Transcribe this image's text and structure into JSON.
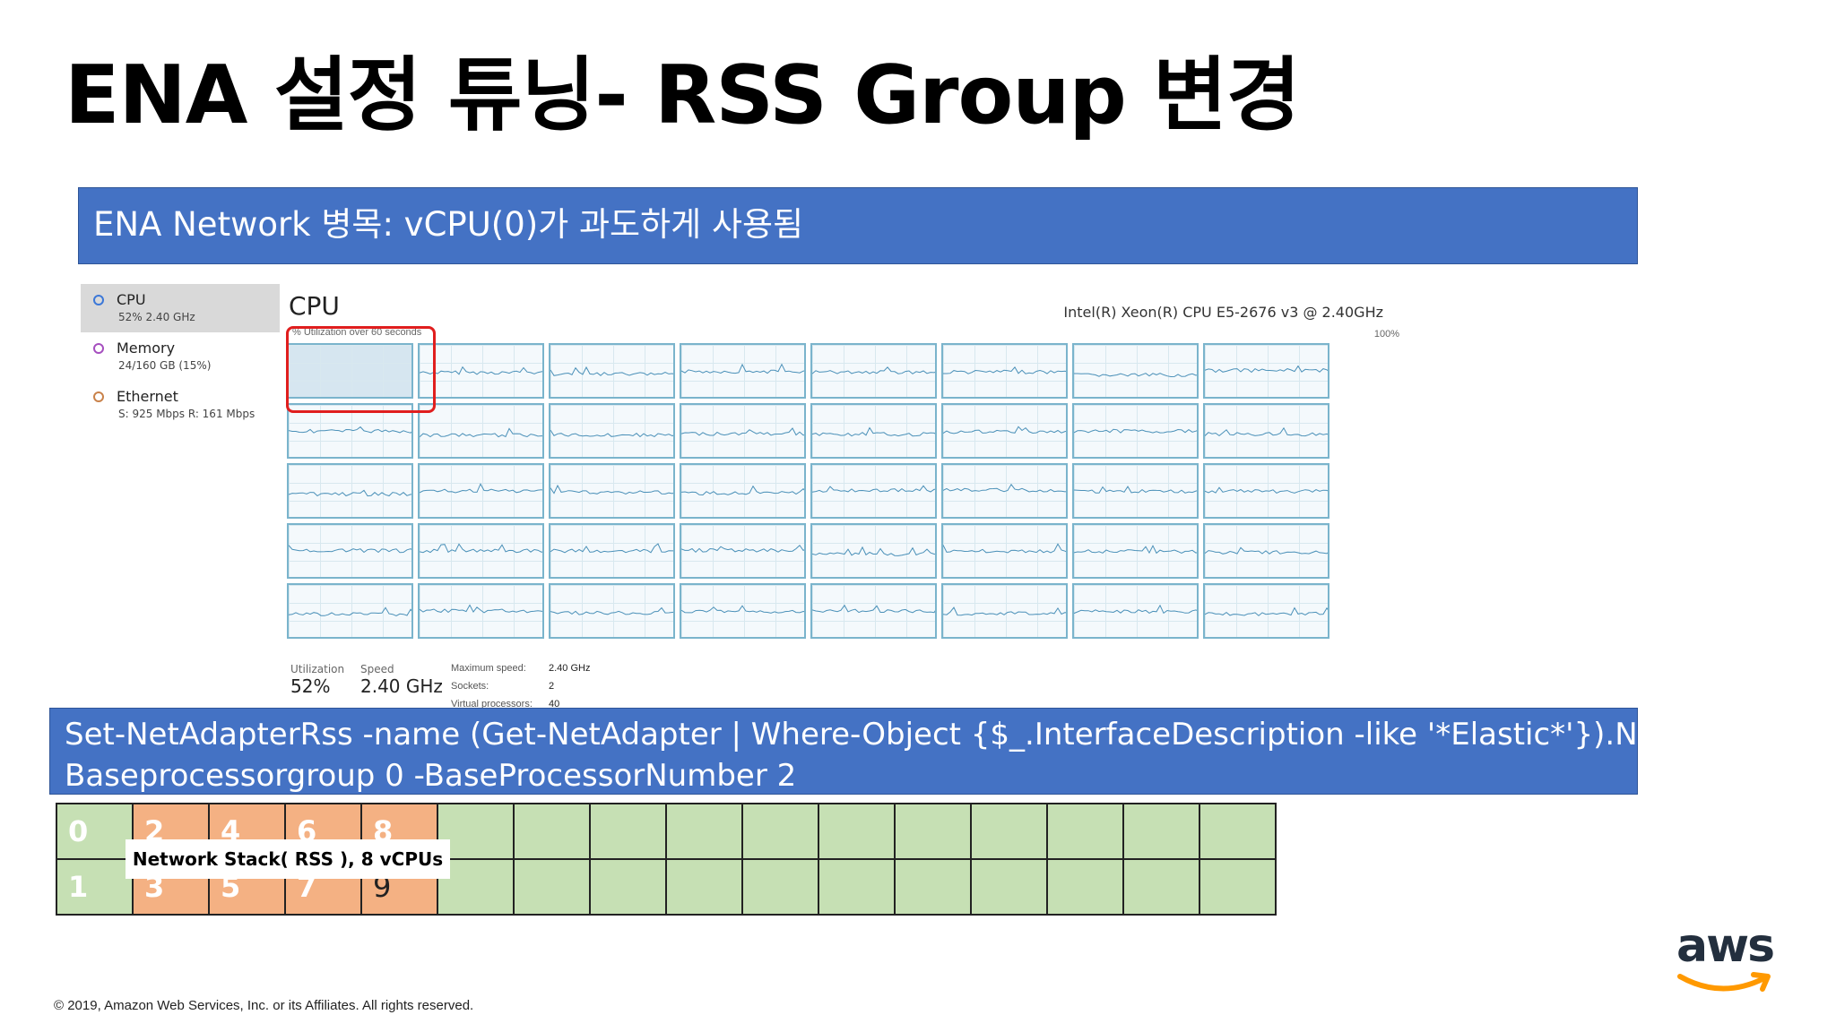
{
  "slide": {
    "title": "ENA 설정 튜닝- RSS Group 변경",
    "top_banner": "ENA Network 병목: vCPU(0)가 과도하게 사용됨",
    "command_line1": "Set-NetAdapterRss -name (Get-NetAdapter | Where-Object {$_.InterfaceDescription -like '*Elastic*'}).Name -",
    "command_line2": "Baseprocessorgroup 0 -BaseProcessorNumber 2",
    "network_stack_label": "Network Stack( RSS ), 8 vCPUs",
    "copyright": "© 2019, Amazon Web Services, Inc. or its Affiliates. All rights reserved.",
    "logo_text": "aws"
  },
  "task_manager": {
    "sidebar": [
      {
        "name": "CPU",
        "sub": "52%  2.40 GHz",
        "color": "#3c78d8",
        "selected": true
      },
      {
        "name": "Memory",
        "sub": "24/160 GB (15%)",
        "color": "#a64fbf",
        "selected": false
      },
      {
        "name": "Ethernet",
        "sub": "S: 925 Mbps  R: 161 Mbps",
        "color": "#c9824a",
        "selected": false
      }
    ],
    "cpu_title": "CPU",
    "cpu_model": "Intel(R) Xeon(R) CPU E5-2676 v3 @ 2.40GHz",
    "graph_label": "% Utilization over 60 seconds",
    "graph_max": "100%",
    "stats": {
      "utilization_label": "Utilization",
      "utilization_value": "52%",
      "speed_label": "Speed",
      "speed_value": "2.40 GHz"
    },
    "specs": {
      "max_speed_label": "Maximum speed:",
      "max_speed_value": "2.40 GHz",
      "sockets_label": "Sockets:",
      "sockets_value": "2",
      "vproc_label": "Virtual processors:",
      "vproc_value": "40"
    }
  },
  "rss_table": {
    "top_row": [
      "0",
      "2",
      "4",
      "6",
      "8",
      "",
      "",
      "",
      "",
      "",
      "",
      "",
      "",
      "",
      "",
      ""
    ],
    "bottom_row": [
      "1",
      "3",
      "5",
      "7",
      "9",
      "",
      "",
      "",
      "",
      "",
      "",
      "",
      "",
      "",
      "",
      ""
    ],
    "orange_columns": [
      1,
      2,
      3,
      4
    ]
  }
}
